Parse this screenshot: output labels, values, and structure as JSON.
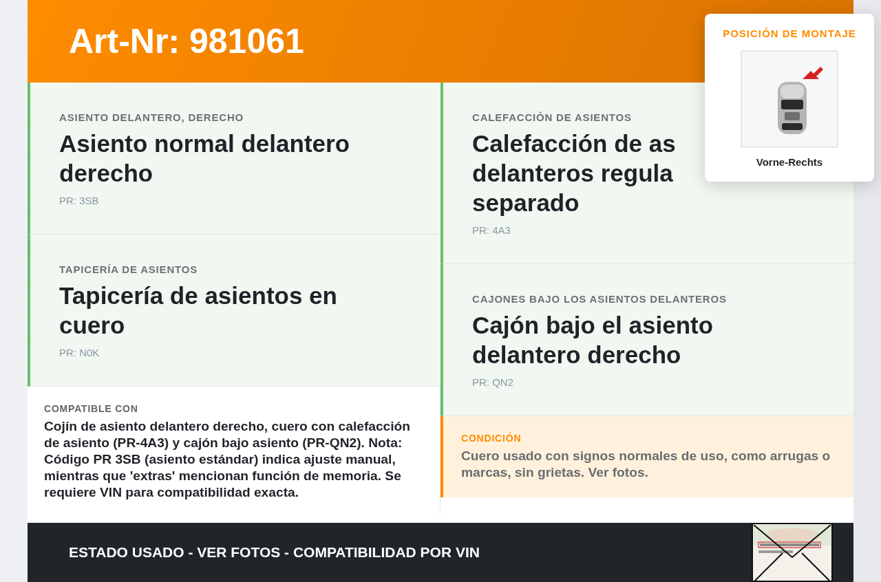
{
  "header": {
    "title": "Art-Nr: 981061"
  },
  "mounting_position": {
    "heading": "POSICIÓN DE MONTAJE",
    "label": "Vorne-Rechts"
  },
  "columns": [
    [
      {
        "kind": "feature",
        "category": "ASIENTO DELANTERO, DERECHO",
        "title": "Asiento normal delantero derecho",
        "code": "PR: 3SB"
      },
      {
        "kind": "feature",
        "category": "TAPICERÍA DE ASIENTOS",
        "title": "Tapicería de asientos en cuero",
        "code": "PR: N0K"
      },
      {
        "kind": "compatible",
        "category": "COMPATIBLE CON",
        "text": "Cojín de asiento delantero derecho, cuero con calefacción de asiento (PR-4A3) y cajón bajo asiento (PR-QN2). Nota: Código PR 3SB (asiento estándar) indica ajuste manual, mientras que 'extras' mencionan función de memoria. Se requiere VIN para compatibilidad exacta."
      }
    ],
    [
      {
        "kind": "feature",
        "category": "CALEFACCIÓN DE ASIENTOS",
        "title_lines": [
          "Calefacción de as",
          "delanteros regula",
          "separado"
        ],
        "code": "PR: 4A3"
      },
      {
        "kind": "feature",
        "category": "CAJONES BAJO LOS ASIENTOS DELANTEROS",
        "title": "Cajón bajo el asiento delantero derecho",
        "code": "PR: QN2"
      },
      {
        "kind": "condition",
        "category": "CONDICIÓN",
        "text": "Cuero usado con signos normales de uso, como arrugas o marcas, sin grietas. Ver fotos."
      }
    ]
  ],
  "footer": {
    "text": "ESTADO USADO - VER FOTOS - COMPATIBILIDAD POR VIN"
  }
}
